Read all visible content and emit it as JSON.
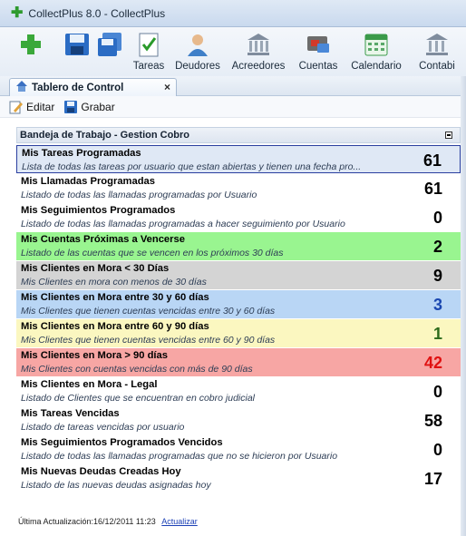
{
  "window": {
    "title": "CollectPlus 8.0 - CollectPlus"
  },
  "toolbar": {
    "items": [
      {
        "label": "",
        "icon": "add-icon"
      },
      {
        "label": "",
        "icon": "save-icon"
      },
      {
        "label": "",
        "icon": "save-all-icon"
      },
      {
        "label": "Tareas",
        "icon": "tasks-icon"
      },
      {
        "label": "Deudores",
        "icon": "debtors-icon"
      },
      {
        "label": "Acreedores",
        "icon": "creditors-icon"
      },
      {
        "label": "Cuentas",
        "icon": "accounts-icon"
      },
      {
        "label": "Calendario",
        "icon": "calendar-icon"
      },
      {
        "label": "Contabi",
        "icon": "accounting-icon"
      }
    ]
  },
  "tab": {
    "label": "Tablero de Control",
    "close": "×"
  },
  "actions": {
    "edit": "Editar",
    "save": "Grabar"
  },
  "panel": {
    "title": "Bandeja de Trabajo - Gestion Cobro",
    "rows": [
      {
        "title": "Mis Tareas Programadas",
        "desc": "Lista de todas las tareas por usuario que estan abiertas y tienen una fecha pro...",
        "count": "61",
        "bg": "#dfe8f5",
        "count_color": "#000000"
      },
      {
        "title": "Mis Llamadas Programadas",
        "desc": "Listado de todas las llamadas programadas por Usuario",
        "count": "61",
        "bg": "#ffffff",
        "count_color": "#000000"
      },
      {
        "title": "Mis Seguimientos Programados",
        "desc": "Listado de todas las llamadas programadas a hacer seguimiento por Usuario",
        "count": "0",
        "bg": "#ffffff",
        "count_color": "#000000"
      },
      {
        "title": "Mis Cuentas Próximas a Vencerse",
        "desc": "Listado de las cuentas que se vencen en los próximos  30 días",
        "count": "2",
        "bg": "#99f590",
        "count_color": "#000000"
      },
      {
        "title": "Mis Clientes en Mora < 30 Días",
        "desc": "Mis Clientes en mora con menos de 30 días",
        "count": "9",
        "bg": "#d4d4d4",
        "count_color": "#000000"
      },
      {
        "title": "Mis Clientes en Mora entre 30 y 60 días",
        "desc": "Mis Clientes que tienen cuentas vencidas entre 30 y 60 días",
        "count": "3",
        "bg": "#b9d6f5",
        "count_color": "#1a47b0"
      },
      {
        "title": "Mis Clientes en Mora entre 60 y 90 días",
        "desc": "Mis Clientes que tienen cuentas vencidas entre 60 y 90 días",
        "count": "1",
        "bg": "#fbf7c0",
        "count_color": "#2c6a1a"
      },
      {
        "title": "Mis Clientes en Mora > 90 días",
        "desc": "Mis Clientes con cuentas vencidas con más de 90 días",
        "count": "42",
        "bg": "#f7a6a4",
        "count_color": "#e01010"
      },
      {
        "title": "Mis Clientes en Mora - Legal",
        "desc": "Listado de Clientes que se encuentran en cobro judicial",
        "count": "0",
        "bg": "#ffffff",
        "count_color": "#000000"
      },
      {
        "title": "Mis Tareas Vencidas",
        "desc": "Listado de tareas vencidas por usuario",
        "count": "58",
        "bg": "#ffffff",
        "count_color": "#000000"
      },
      {
        "title": "Mis Seguimientos Programados Vencidos",
        "desc": "Listado de todas las llamadas programadas que no se hicieron por Usuario",
        "count": "0",
        "bg": "#ffffff",
        "count_color": "#000000"
      },
      {
        "title": "Mis Nuevas Deudas Creadas Hoy",
        "desc": "Listado de las nuevas deudas asignadas hoy",
        "count": "17",
        "bg": "#ffffff",
        "count_color": "#000000"
      }
    ]
  },
  "footer": {
    "text": "Última Actualización:16/12/2011 11:23",
    "link": "Actualizar"
  }
}
